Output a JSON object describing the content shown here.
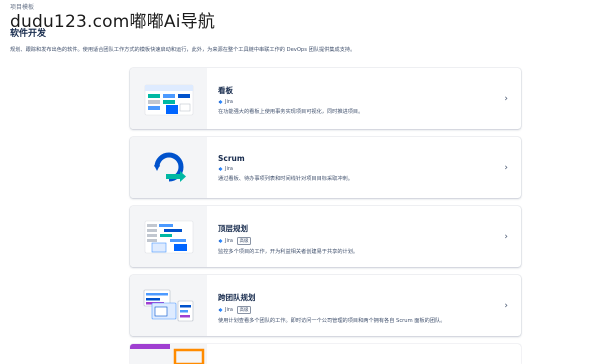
{
  "header": {
    "breadcrumb": "项目模板",
    "watermark": "dudu123.com嘟嘟Ai导航",
    "title": "软件开发",
    "description": "规划、跟踪和发布出色的软件。使用适合团队工作方式的模板快速启动和运行，此外，为来源在整个工具链中串联工作的 DevOps 团队提供集成支持。"
  },
  "cards": [
    {
      "title": "看板",
      "product": "Jira",
      "badge": "",
      "description": "在功能强大的看板上使用事务实现项目可视化，同时推进项目。",
      "thumb_icon": "board-preview-icon"
    },
    {
      "title": "Scrum",
      "product": "Jira",
      "badge": "",
      "description": "通过看板、待办事项列表和时间线针对项目目标采取冲刺。",
      "thumb_icon": "scrum-cycle-icon"
    },
    {
      "title": "顶层规划",
      "product": "Jira",
      "badge": "高级",
      "description": "监控多个项目的工作，开为利益相关者创建易于共享的计划。",
      "thumb_icon": "plan-preview-icon"
    },
    {
      "title": "跨团队规划",
      "product": "Jira",
      "badge": "高级",
      "description": "使用计划查看多个团队的工作。即时访问一个公司管理的项目和两个拥有各自 Scrum 面板的团队。",
      "thumb_icon": "cross-team-preview-icon"
    }
  ],
  "colors": {
    "accent": "#0052cc",
    "teal": "#00b8a3",
    "purple": "#a03fd1",
    "orange": "#ff8b00"
  }
}
